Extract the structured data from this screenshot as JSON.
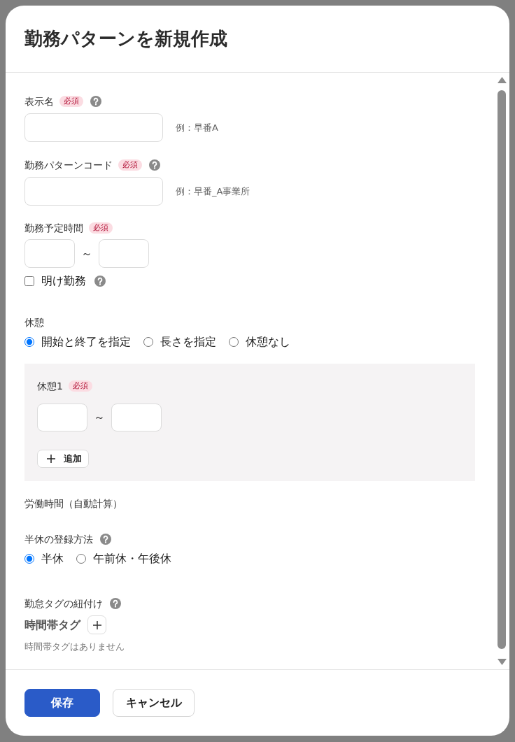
{
  "dialog": {
    "title": "勤務パターンを新規作成"
  },
  "sections": [
    {
      "kind": "text_input",
      "label": "表示名",
      "badge": "必須",
      "help": true,
      "hint": "例：早番A"
    },
    {
      "kind": "text_input",
      "label": "勤務パターンコード",
      "badge": "必須",
      "help": true,
      "hint": "例：早番_A事業所"
    },
    {
      "kind": "time_range",
      "label": "勤務予定時間",
      "badge": "必須",
      "separator": "～",
      "checkbox": {
        "label": "明け勤務",
        "checked": false,
        "help": true
      }
    },
    {
      "kind": "radio_group",
      "label": "休憩",
      "options": [
        {
          "label": "開始と終了を指定",
          "selected": true
        },
        {
          "label": "長さを指定",
          "selected": false
        },
        {
          "label": "休憩なし",
          "selected": false
        }
      ]
    },
    {
      "kind": "break_panel",
      "breaks": [
        {
          "label": "休憩1",
          "badge": "必須",
          "separator": "～"
        }
      ],
      "add_button": "追加"
    },
    {
      "kind": "plain_label",
      "label": "労働時間（自動計算）"
    },
    {
      "kind": "radio_group",
      "label": "半休の登録方法",
      "help": true,
      "options": [
        {
          "label": "半休",
          "selected": true
        },
        {
          "label": "午前休・午後休",
          "selected": false
        }
      ]
    },
    {
      "kind": "tags",
      "label": "勤怠タグの紐付け",
      "help": true,
      "group_title": "時間帯タグ",
      "empty_text": "時間帯タグはありません"
    }
  ],
  "buttons": [
    {
      "kind": "primary",
      "label": "保存"
    },
    {
      "kind": "secondary",
      "label": "キャンセル"
    }
  ]
}
